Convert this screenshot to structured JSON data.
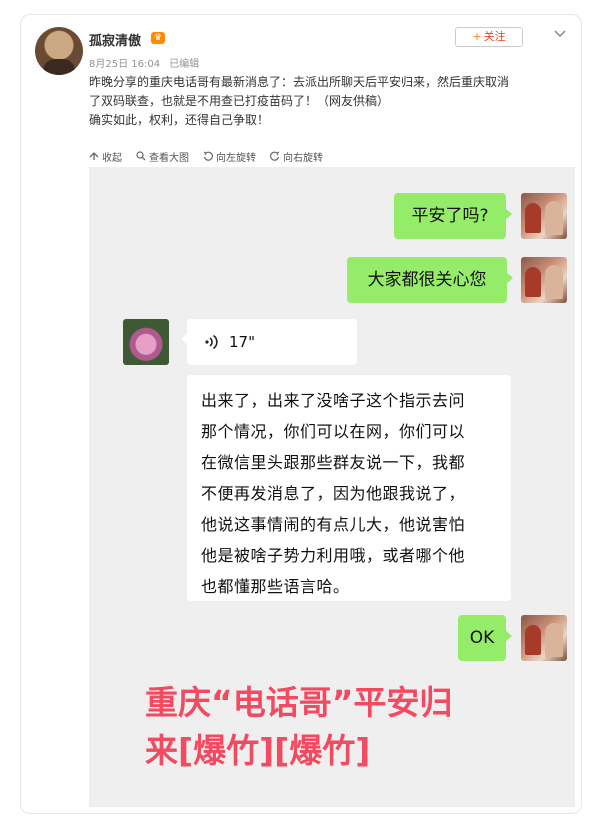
{
  "post": {
    "username": "孤寂清傲",
    "date": "8月25日 16:04",
    "edited": "已编辑",
    "follow_label": "关注",
    "text_line1": "昨晚分享的重庆电话哥有最新消息了：去派出所聊天后平安归来，然后重庆取消",
    "text_line2": "了双码联查，也就是不用查已打疫苗码了！（网友供稿）",
    "text_line3": "确实如此，权利，还得自己争取！"
  },
  "toolbar": {
    "collapse": "收起",
    "view_large": "查看大图",
    "rotate_left": "向左旋转",
    "rotate_right": "向右旋转"
  },
  "chat": {
    "msg1": "平安了吗?",
    "msg2": "大家都很关心您",
    "voice_duration": "17\"",
    "long_msg": [
      "出来了，出来了没啥子这个指示去问",
      "那个情况，你们可以在网，你们可以",
      "在微信里头跟那些群友说一下，我都",
      "不便再发消息了，因为他跟我说了，",
      "他说这事情闹的有点儿大，他说害怕",
      "他是被啥子势力利用哦，或者哪个他",
      "也都懂那些语言哈。"
    ],
    "msg_ok": "OK",
    "headline_line1": "重庆“电话哥”平安归",
    "headline_line2": "来[爆竹][爆竹]"
  },
  "colors": {
    "green_bubble": "#95ec69",
    "headline": "#f24a60",
    "follow": "#ff8200"
  },
  "icons": [
    "collapse-icon",
    "search-icon",
    "rotate-left-icon",
    "rotate-right-icon",
    "chevron-down-icon",
    "voice-icon"
  ]
}
